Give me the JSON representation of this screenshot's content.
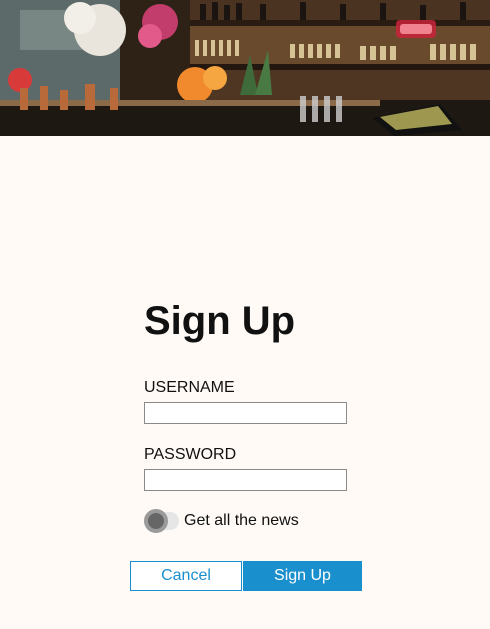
{
  "hero": {
    "image": "bar-interior-photo",
    "neon_sign": "neon sign"
  },
  "signup": {
    "title": "Sign Up",
    "username_label": "USERNAME",
    "username_value": "",
    "password_label": "PASSWORD",
    "password_value": "",
    "newsletter_label": "Get all the news",
    "newsletter_on": false,
    "cancel_label": "Cancel",
    "submit_label": "Sign Up"
  },
  "colors": {
    "background": "#fffaf6",
    "accent": "#1a8fce",
    "text": "#111111",
    "toggle_track": "#e6e6e6",
    "toggle_knob": "#666666"
  }
}
